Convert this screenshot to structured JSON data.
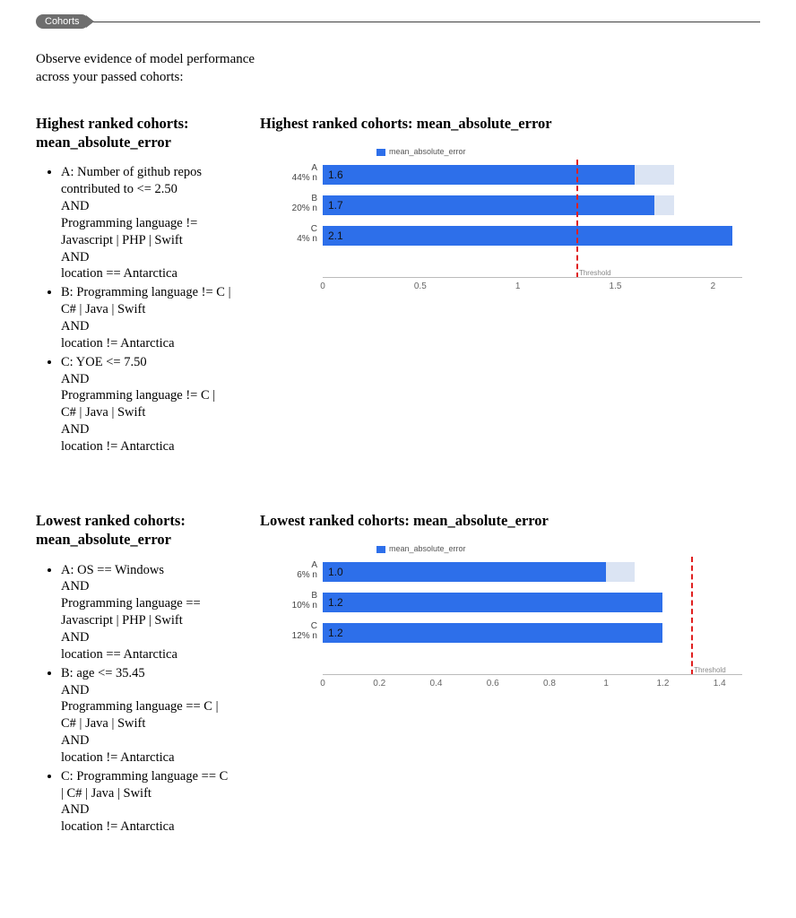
{
  "tag": "Cohorts",
  "intro": "Observe evidence of model performance across your passed cohorts:",
  "sections": {
    "highest": {
      "left_title": "Highest ranked cohorts: mean_absolute_error",
      "right_title": "Highest ranked cohorts: mean_absolute_error",
      "cohorts": [
        {
          "label": "A",
          "lines": [
            "A: Number of github repos contributed to <= 2.50",
            "AND",
            "Programming language != Javascript | PHP | Swift",
            "AND",
            "location == Antarctica"
          ]
        },
        {
          "label": "B",
          "lines": [
            "B: Programming language != C | C# | Java | Swift",
            "AND",
            "location != Antarctica"
          ]
        },
        {
          "label": "C",
          "lines": [
            "C: YOE <= 7.50",
            "AND",
            "Programming language != C | C# | Java | Swift",
            "AND",
            "location != Antarctica"
          ]
        }
      ]
    },
    "lowest": {
      "left_title": "Lowest ranked cohorts: mean_absolute_error",
      "right_title": "Lowest ranked cohorts: mean_absolute_error",
      "cohorts": [
        {
          "label": "A",
          "lines": [
            "A: OS == Windows",
            "AND",
            "Programming language == Javascript | PHP | Swift",
            "AND",
            "location == Antarctica"
          ]
        },
        {
          "label": "B",
          "lines": [
            "B: age <= 35.45",
            "AND",
            "Programming language == C | C# | Java | Swift",
            "AND",
            "location != Antarctica"
          ]
        },
        {
          "label": "C",
          "lines": [
            "C: Programming language == C | C# | Java | Swift",
            "AND",
            "location != Antarctica"
          ]
        }
      ]
    }
  },
  "chart_data": [
    {
      "id": "highest",
      "type": "bar",
      "orientation": "horizontal",
      "legend": "mean_absolute_error",
      "threshold": 1.3,
      "threshold_label": "Threshold",
      "xmax": 2.15,
      "xticks": [
        0,
        0.5,
        1,
        1.5,
        2
      ],
      "bars": [
        {
          "cat": "A",
          "sub": "44% n",
          "value": 1.6,
          "bg": 1.8
        },
        {
          "cat": "B",
          "sub": "20% n",
          "value": 1.7,
          "bg": 1.8
        },
        {
          "cat": "C",
          "sub": "4% n",
          "value": 2.1,
          "bg": 2.1
        }
      ]
    },
    {
      "id": "lowest",
      "type": "bar",
      "orientation": "horizontal",
      "legend": "mean_absolute_error",
      "threshold": 1.3,
      "threshold_label": "Threshold",
      "xmax": 1.48,
      "xticks": [
        0,
        0.2,
        0.4,
        0.6,
        0.8,
        1,
        1.2,
        1.4
      ],
      "bars": [
        {
          "cat": "A",
          "sub": "6% n",
          "value": 1.0,
          "bg": 1.1
        },
        {
          "cat": "B",
          "sub": "10% n",
          "value": 1.2,
          "bg": 1.2
        },
        {
          "cat": "C",
          "sub": "12% n",
          "value": 1.2,
          "bg": 1.2
        }
      ]
    }
  ]
}
